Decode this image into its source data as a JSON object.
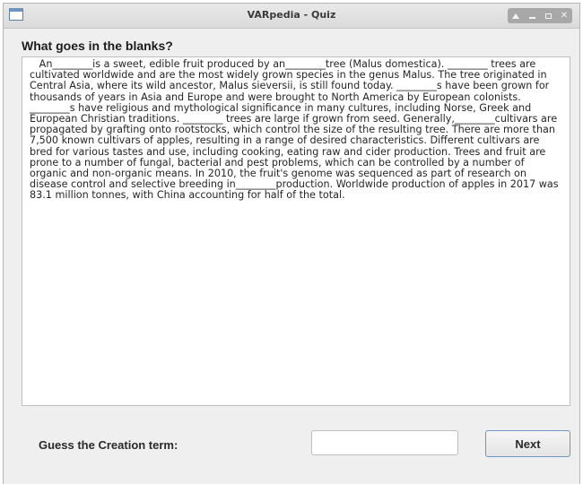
{
  "window": {
    "title": "VARpedia - Quiz",
    "controls": {
      "up": "▲",
      "close": "✕"
    }
  },
  "quiz": {
    "question": "What goes in the blanks?",
    "passage": "   An________is a sweet, edible fruit produced by an________tree (Malus domestica). ________ trees are cultivated worldwide and are the most widely grown species in the genus Malus. The tree originated in Central Asia, where its wild ancestor, Malus sieversii, is still found today. ________s have been grown for thousands of years in Asia and Europe and were brought to North America by European colonists. ________s have religious and mythological significance in many cultures, including Norse, Greek and European Christian traditions. ________ trees are large if grown from seed. Generally,________cultivars are propagated by grafting onto rootstocks, which control the size of the resulting tree. There are more than 7,500 known cultivars of apples, resulting in a range of desired characteristics. Different cultivars are bred for various tastes and use, including cooking, eating raw and cider production. Trees and fruit are prone to a number of fungal, bacterial and pest problems, which can be controlled by a number of organic and non-organic means. In 2010, the fruit's genome was sequenced as part of research on disease control and selective breeding in________production. Worldwide production of apples in 2017 was 83.1 million tonnes, with China accounting for half of the total.",
    "guess_label": "Guess the Creation term:",
    "answer_value": "",
    "next_label": "Next"
  }
}
